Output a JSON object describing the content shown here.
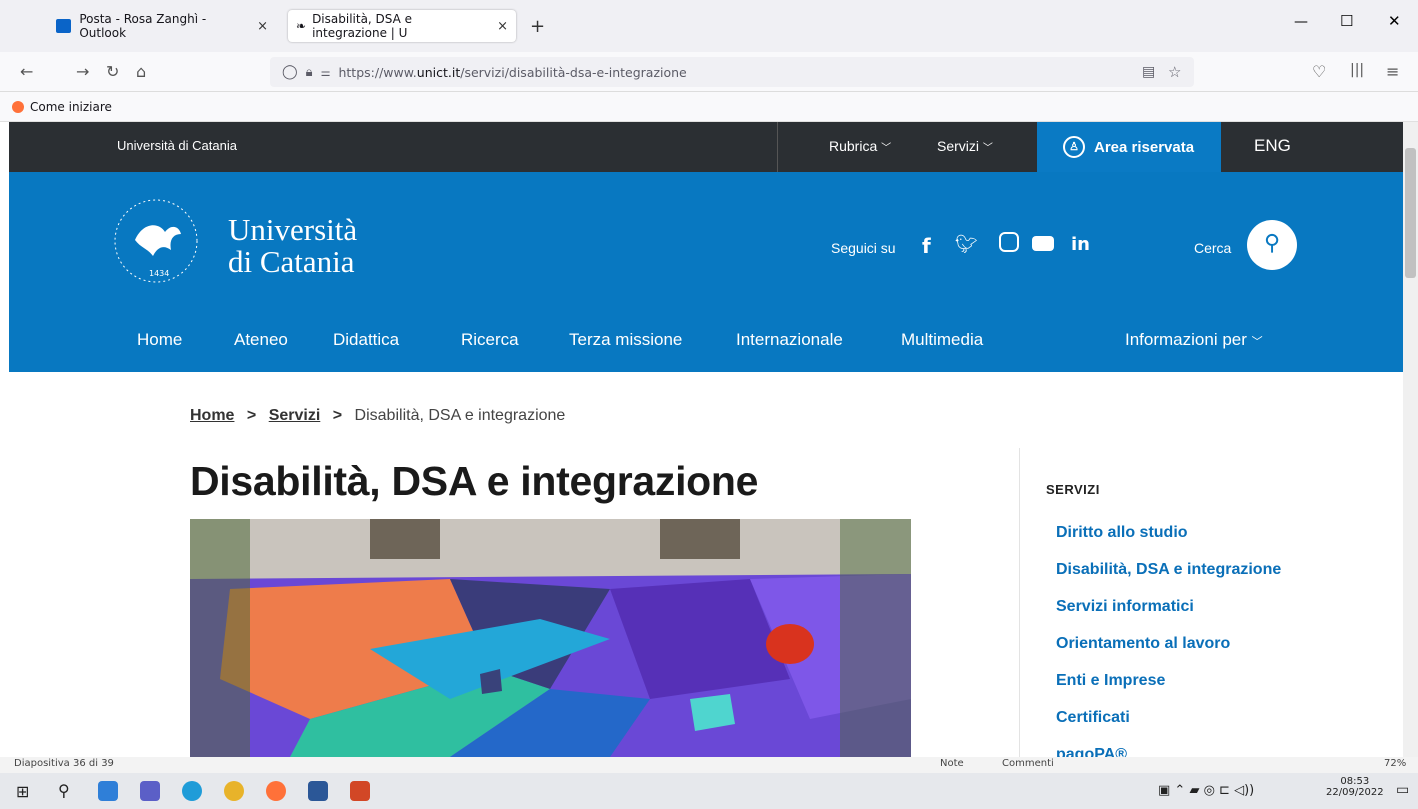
{
  "browser": {
    "tabs": [
      {
        "label": "Posta - Rosa Zanghì - Outlook",
        "close": "×"
      },
      {
        "label": "Disabilità, DSA e integrazione | U",
        "close": "×"
      }
    ],
    "new_tab": "+",
    "window_controls": {
      "min": "—",
      "max": "☐",
      "close": "✕"
    },
    "url_host": "https://www.",
    "url_domain": "unict.it",
    "url_path": "/servizi/disabilità-dsa-e-integrazione",
    "bookmark": "Come iniziare"
  },
  "site": {
    "top": {
      "university": "Università di Catania",
      "rubrica": "Rubrica",
      "servizi": "Servizi",
      "area": "Area riservata",
      "lang": "ENG"
    },
    "logo": {
      "line1": "Università",
      "line2": "di Catania",
      "seal_year": "1434"
    },
    "social_label": "Seguici su",
    "search_label": "Cerca",
    "menu": [
      "Home",
      "Ateneo",
      "Didattica",
      "Ricerca",
      "Terza missione",
      "Internazionale",
      "Multimedia"
    ],
    "menu_right": "Informazioni per",
    "breadcrumb": {
      "home": "Home",
      "sep": ">",
      "servizi": "Servizi",
      "current": "Disabilità, DSA e integrazione"
    },
    "title": "Disabilità, DSA e integrazione",
    "sidebar": {
      "heading": "SERVIZI",
      "links": [
        "Diritto allo studio",
        "Disabilità, DSA e integrazione",
        "Servizi informatici",
        "Orientamento al lavoro",
        "Enti e Imprese",
        "Certificati",
        "pagoPA®"
      ]
    }
  },
  "statusline": {
    "slide": "Diapositiva 36 di 39",
    "note": "Note",
    "comments": "Commenti",
    "zoom": "72%"
  },
  "taskbar": {
    "time": "08:53",
    "date": "22/09/2022"
  },
  "colors": {
    "brand": "#0878c1",
    "topbar": "#2b2f33"
  }
}
